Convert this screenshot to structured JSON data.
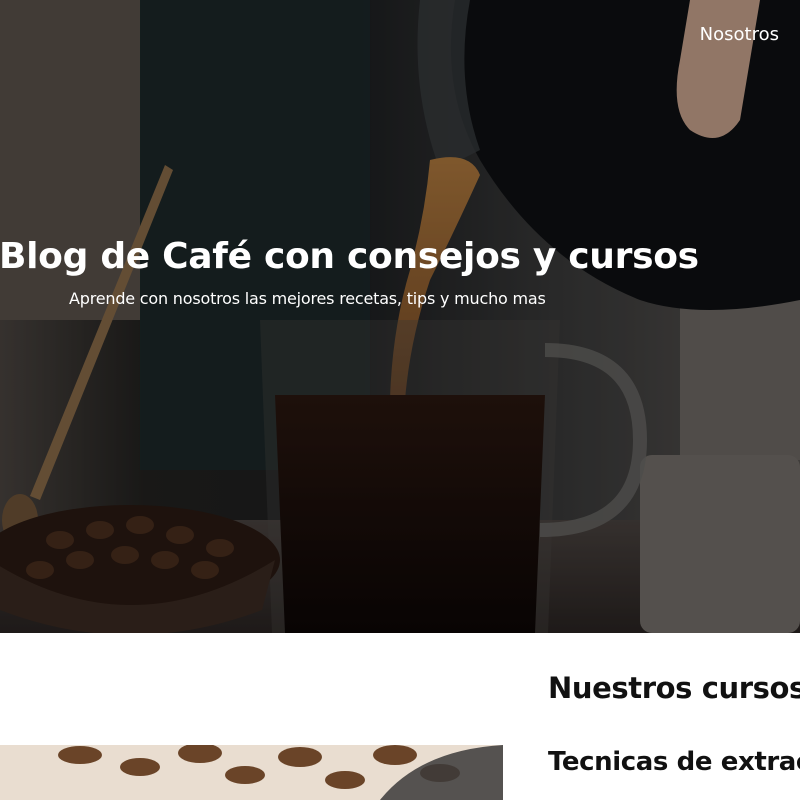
{
  "nav": {
    "about_label": "Nosotros"
  },
  "hero": {
    "title": "Blog de Café con consejos y cursos",
    "subtitle": "Aprende con nosotros las mejores recetas, tips y mucho mas",
    "image_description_icon": "coffee-pour-photo"
  },
  "content": {
    "courses_heading": "Nuestros cursos y",
    "card": {
      "title": "Tecnicas de extracci",
      "image_icon": "coffee-beans-photo"
    }
  },
  "colors": {
    "hero_text": "#ffffff",
    "heading_text": "#111111",
    "page_background": "#ffffff"
  }
}
